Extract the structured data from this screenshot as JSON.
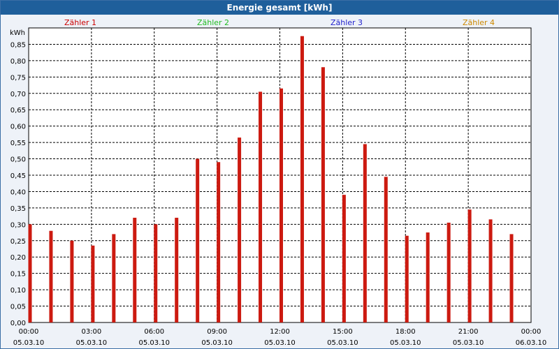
{
  "window": {
    "title": "Energie gesamt [kWh]"
  },
  "colors": {
    "bar": "#cc1a10",
    "grid": "#000000",
    "plot_bg": "#ffffff",
    "title_bg": "#1f5f9b"
  },
  "legend": [
    {
      "label": "Zähler 1",
      "color": "#cc0000"
    },
    {
      "label": "Zähler 2",
      "color": "#22bb22"
    },
    {
      "label": "Zähler 3",
      "color": "#2222cc"
    },
    {
      "label": "Zähler 4",
      "color": "#cc8800"
    }
  ],
  "chart_data": {
    "type": "bar",
    "title": "Energie gesamt [kWh]",
    "ylabel": "kWh",
    "ylim": [
      0,
      0.9
    ],
    "y_ticks": [
      "0,00",
      "0,05",
      "0,10",
      "0,15",
      "0,20",
      "0,25",
      "0,30",
      "0,35",
      "0,40",
      "0,45",
      "0,50",
      "0,55",
      "0,60",
      "0,65",
      "0,70",
      "0,75",
      "0,80",
      "0,85"
    ],
    "x_ticks": [
      {
        "time": "00:00",
        "date": "05.03.10"
      },
      {
        "time": "03:00",
        "date": "05.03.10"
      },
      {
        "time": "06:00",
        "date": "05.03.10"
      },
      {
        "time": "09:00",
        "date": "05.03.10"
      },
      {
        "time": "12:00",
        "date": "05.03.10"
      },
      {
        "time": "15:00",
        "date": "05.03.10"
      },
      {
        "time": "18:00",
        "date": "05.03.10"
      },
      {
        "time": "21:00",
        "date": "05.03.10"
      },
      {
        "time": "00:00",
        "date": "06.03.10"
      }
    ],
    "xlim_hours": [
      0,
      24
    ],
    "grid": true,
    "series": [
      {
        "name": "Zähler 1",
        "hours": [
          0,
          1,
          2,
          3,
          4,
          5,
          6,
          7,
          8,
          9,
          10,
          11,
          12,
          13,
          14,
          15,
          16,
          17,
          18,
          19,
          20,
          21,
          22,
          23
        ],
        "values": [
          0.3,
          0.28,
          0.25,
          0.235,
          0.27,
          0.32,
          0.3,
          0.32,
          0.5,
          0.49,
          0.565,
          0.705,
          0.715,
          0.875,
          0.78,
          0.39,
          0.545,
          0.445,
          0.265,
          0.275,
          0.305,
          0.345,
          0.315,
          0.27
        ]
      }
    ]
  }
}
